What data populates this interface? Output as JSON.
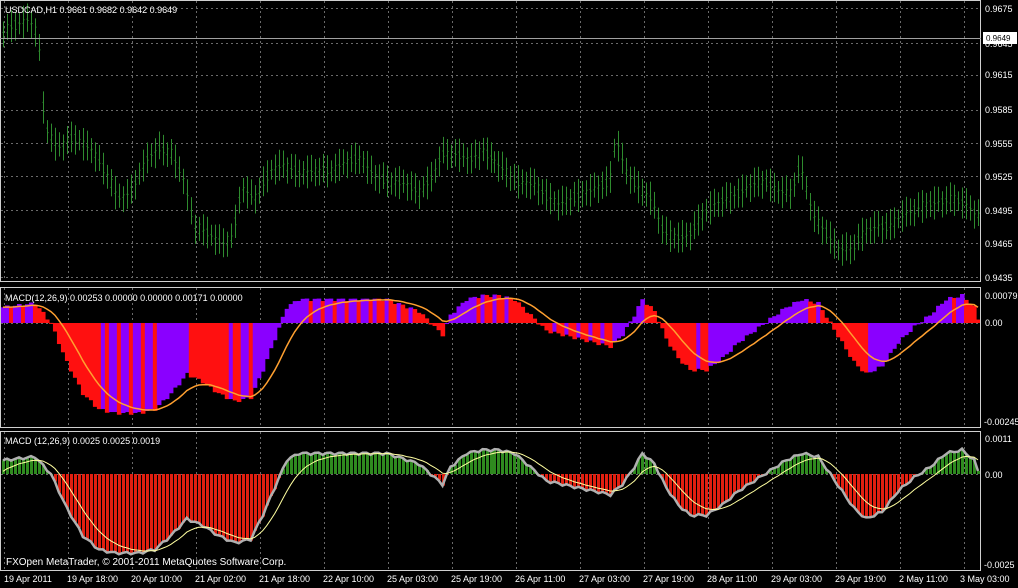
{
  "main": {
    "symbol_header": "USDCAD,H1  0.9661 0.9682 0.9642 0.9649",
    "current_price": "0.9649",
    "price_axis": [
      "0.9675",
      "0.9645",
      "0.9615",
      "0.9585",
      "0.9555",
      "0.9525",
      "0.9495",
      "0.9465",
      "0.9435"
    ],
    "colors": {
      "bars": "#2e8b2e",
      "grid": "#6a6a6a",
      "background": "#000000"
    }
  },
  "macd1": {
    "header": "MACD(12,26,9) 0.00253 0.00000 0.00000 0.00171 0.00000",
    "axis": [
      "0.00079",
      "0.00",
      "-0.00245"
    ],
    "colors": {
      "up": "#8a00ff",
      "down": "#ff1010",
      "signal": "#ffa030"
    }
  },
  "macd2": {
    "header": "MACD (12,26,9) 0.0025 0.0025 0.0019",
    "axis": [
      "0.0011",
      "0.00",
      "-0.0025"
    ],
    "colors": {
      "up": "#2f8a1f",
      "down": "#e11f10",
      "main": "#b0b0b0",
      "signal": "#ffffa0"
    }
  },
  "copyright": "FXOpen MetaTrader, © 2001-2011 MetaQuotes Software Corp.",
  "time_axis": [
    "19 Apr 2011",
    "19 Apr 18:00",
    "20 Apr 10:00",
    "21 Apr 02:00",
    "21 Apr 18:00",
    "22 Apr 10:00",
    "25 Apr 03:00",
    "25 Apr 19:00",
    "26 Apr 11:00",
    "27 Apr 03:00",
    "27 Apr 19:00",
    "28 Apr 11:00",
    "29 Apr 03:00",
    "29 Apr 19:00",
    "2 May 11:00",
    "3 May 03:00"
  ],
  "chart_data": [
    {
      "type": "line",
      "title": "USDCAD,H1  0.9661 0.9682 0.9642 0.9649",
      "x": [
        "19 Apr 2011",
        "19 Apr 18:00",
        "20 Apr 10:00",
        "21 Apr 02:00",
        "21 Apr 18:00",
        "22 Apr 10:00",
        "25 Apr 03:00",
        "25 Apr 19:00",
        "26 Apr 11:00",
        "27 Apr 03:00",
        "27 Apr 19:00",
        "28 Apr 11:00",
        "29 Apr 03:00",
        "29 Apr 19:00",
        "2 May 11:00",
        "3 May 03:00"
      ],
      "y": [
        0.9655,
        0.956,
        0.952,
        0.947,
        0.9535,
        0.9535,
        0.9525,
        0.9545,
        0.951,
        0.951,
        0.947,
        0.951,
        0.952,
        0.946,
        0.9495,
        0.947
      ],
      "ylim": [
        0.9435,
        0.9675
      ]
    },
    {
      "type": "bar",
      "title": "MACD(12,26,9) 0.00253 0.00000 0.00000 0.00171 0.00000",
      "x": [
        "19 Apr 2011",
        "19 Apr 18:00",
        "20 Apr 10:00",
        "21 Apr 02:00",
        "21 Apr 18:00",
        "22 Apr 10:00",
        "25 Apr 03:00",
        "25 Apr 19:00",
        "26 Apr 11:00",
        "27 Apr 03:00",
        "27 Apr 19:00",
        "28 Apr 11:00",
        "29 Apr 03:00",
        "29 Apr 19:00",
        "2 May 11:00",
        "3 May 03:00"
      ],
      "values": [
        0.0004,
        -0.001,
        -0.0023,
        -0.0015,
        0.0007,
        0.0006,
        -0.0003,
        0.0007,
        -0.0006,
        -0.0008,
        -0.0012,
        -0.0002,
        0.0006,
        -0.0013,
        0.0003,
        0.0007
      ],
      "ylim": [
        -0.00245,
        0.00079
      ]
    },
    {
      "type": "bar",
      "title": "MACD (12,26,9) 0.0025 0.0025 0.0019",
      "x": [
        "19 Apr 2011",
        "19 Apr 18:00",
        "20 Apr 10:00",
        "21 Apr 02:00",
        "21 Apr 18:00",
        "22 Apr 10:00",
        "25 Apr 03:00",
        "25 Apr 19:00",
        "26 Apr 11:00",
        "27 Apr 03:00",
        "27 Apr 19:00",
        "28 Apr 11:00",
        "29 Apr 03:00",
        "29 Apr 19:00",
        "2 May 11:00",
        "3 May 03:00"
      ],
      "values": [
        0.0006,
        -0.0014,
        -0.0022,
        -0.0021,
        0.0004,
        0.0005,
        -0.0003,
        0.0005,
        -0.0005,
        -0.001,
        -0.0011,
        -0.0003,
        0.0005,
        -0.0016,
        0.0001,
        0.0006
      ],
      "ylim": [
        -0.0025,
        0.0011
      ]
    }
  ]
}
